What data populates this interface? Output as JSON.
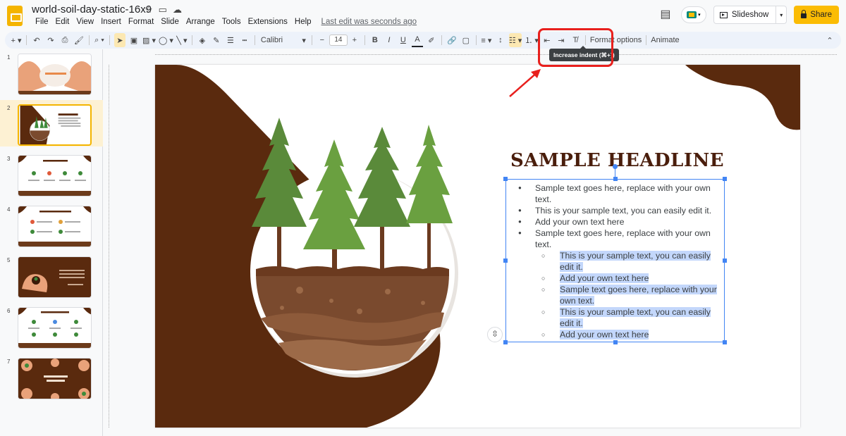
{
  "header": {
    "doc_title": "world-soil-day-static-16x9",
    "menu": [
      "File",
      "Edit",
      "View",
      "Insert",
      "Format",
      "Slide",
      "Arrange",
      "Tools",
      "Extensions",
      "Help"
    ],
    "last_edit": "Last edit was seconds ago",
    "slideshow_label": "Slideshow",
    "share_label": "Share"
  },
  "toolbar": {
    "font": "Calibri",
    "font_size": "14",
    "format_options": "Format options",
    "animate": "Animate",
    "tooltip": "Increase indent (⌘+])"
  },
  "slides": [
    {
      "num": "1"
    },
    {
      "num": "2"
    },
    {
      "num": "3"
    },
    {
      "num": "4"
    },
    {
      "num": "5"
    },
    {
      "num": "6"
    },
    {
      "num": "7"
    }
  ],
  "slide": {
    "headline": "SAMPLE HEADLINE",
    "bullets": [
      {
        "text": "Sample text goes here, replace with your own text.",
        "level": 1
      },
      {
        "text": "This is your sample text, you can easily edit it.",
        "level": 1
      },
      {
        "text": "Add your own text here",
        "level": 1
      },
      {
        "text": "Sample text goes here, replace with your own text.",
        "level": 1
      },
      {
        "text": "This is your sample text, you can easily edit it.",
        "level": 2
      },
      {
        "text": "Add your own text here",
        "level": 2
      },
      {
        "text": "Sample text goes here, replace with your own text.",
        "level": 2
      },
      {
        "text": "This is your sample text, you can easily edit it.",
        "level": 2
      },
      {
        "text": "Add your own text here",
        "level": 2
      }
    ]
  },
  "colors": {
    "accent_yellow": "#fbbc04",
    "soil_brown": "#4a1e0c",
    "selection_blue": "#4285f4",
    "annotation_red": "#e8201d"
  }
}
